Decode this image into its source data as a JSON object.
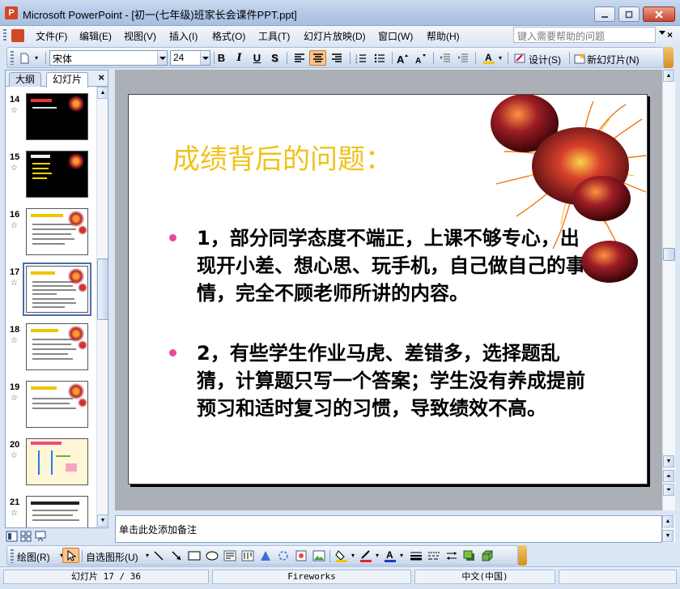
{
  "window": {
    "title": "Microsoft PowerPoint - [初一(七年级)班家长会课件PPT.ppt]",
    "minimize_icon": "minimize-icon",
    "restore_icon": "restore-icon",
    "close_icon": "close-icon"
  },
  "menu": {
    "items": [
      "文件(F)",
      "编辑(E)",
      "视图(V)",
      "插入(I)",
      "格式(O)",
      "工具(T)",
      "幻灯片放映(D)",
      "窗口(W)",
      "帮助(H)"
    ],
    "help_placeholder": "键入需要帮助的问题",
    "close_doc": "×"
  },
  "toolbar": {
    "font_name": "宋体",
    "font_size": "24",
    "bold": "B",
    "italic": "I",
    "underline": "U",
    "shadow": "S",
    "font_color_glyph": "A",
    "design_label": "设计(S)",
    "new_slide_label": "新幻灯片(N)"
  },
  "panel": {
    "tabs": [
      "大纲",
      "幻灯片"
    ],
    "close": "×",
    "thumbnails": [
      {
        "num": "14",
        "style": "dark"
      },
      {
        "num": "15",
        "style": "dark"
      },
      {
        "num": "16",
        "style": "light"
      },
      {
        "num": "17",
        "style": "light",
        "selected": true
      },
      {
        "num": "18",
        "style": "light"
      },
      {
        "num": "19",
        "style": "light"
      },
      {
        "num": "20",
        "style": "cream"
      },
      {
        "num": "21",
        "style": "light"
      }
    ]
  },
  "slide": {
    "title": "成绩背后的问题：",
    "bullets": [
      "1，部分同学态度不端正，上课不够专心，出现开小差、想心思、玩手机，自己做自己的事情，完全不顾老师所讲的内容。",
      "2，有些学生作业马虎、差错多，选择题乱猜，计算题只写一个答案；学生没有养成提前预习和适时复习的习惯，导致绩效不高。"
    ],
    "title_color": "#f0c21a",
    "bullet_color": "#e8489b"
  },
  "notes": {
    "placeholder": "单击此处添加备注"
  },
  "drawbar": {
    "draw_label": "绘图(R)",
    "autoshapes_label": "自选图形(U)"
  },
  "status": {
    "slide_info": "幻灯片 17 / 36",
    "design": "Fireworks",
    "language": "中文(中国)"
  }
}
